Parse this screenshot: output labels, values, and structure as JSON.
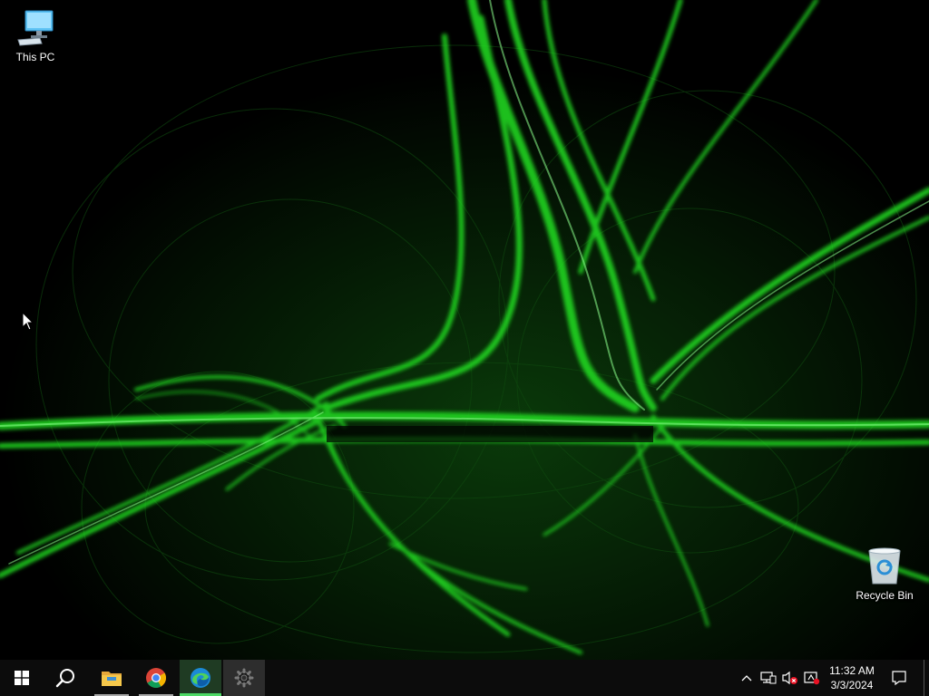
{
  "desktop": {
    "icons": [
      {
        "label": "This PC",
        "icon": "computer-icon"
      },
      {
        "label": "Recycle Bin",
        "icon": "recycle-bin-icon"
      }
    ],
    "wallpaper": {
      "primary_color": "#1aff1a",
      "background": "#000000",
      "icon": "fractal-wallpaper"
    }
  },
  "taskbar": {
    "background": "#0c0c0c",
    "buttons": [
      {
        "name": "start",
        "icon": "windows-logo-icon"
      },
      {
        "name": "search",
        "icon": "search-icon"
      },
      {
        "name": "file-explorer",
        "icon": "folder-icon",
        "running": true
      },
      {
        "name": "chrome",
        "icon": "chrome-icon",
        "running": true
      },
      {
        "name": "edge",
        "icon": "edge-icon",
        "running": true,
        "active": true
      },
      {
        "name": "settings",
        "icon": "gear-icon",
        "running": true
      }
    ],
    "tray": {
      "icons": [
        "chevron-up-icon",
        "network-icon",
        "volume-muted-icon",
        "ime-icon"
      ],
      "time": "11:32 AM",
      "date": "3/3/2024",
      "notification_icon": "notification-icon"
    }
  }
}
